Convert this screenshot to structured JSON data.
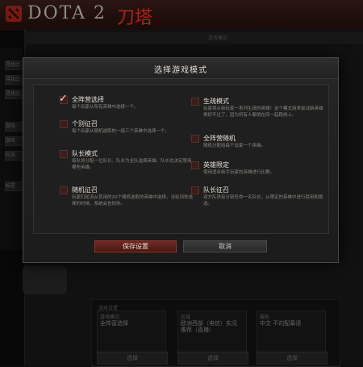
{
  "app": {
    "logo_text": "DOTA 2",
    "logo_cn": "刀塔",
    "topbar_text": "游戏模式"
  },
  "sidebar": {
    "items": [
      "寻找比",
      "寻找比",
      "寻找比",
      "游戏",
      "游戏",
      "队伍",
      "标签"
    ]
  },
  "lobby": {
    "section_title": "游戏设置",
    "columns": [
      {
        "label": "游戏模式",
        "value": "全阵营选择",
        "select": "选择"
      },
      {
        "label": "区域",
        "value": "欧洲西部（电信）实况推荐（直播）",
        "select": "选择"
      },
      {
        "label": "服务",
        "value": "中文 不的配幕语",
        "select": "选择"
      }
    ]
  },
  "dialog": {
    "title": "选择游戏模式",
    "modes_left": [
      {
        "name": "全阵营选择",
        "desc": "每个玩家从所有英雄中选择一个。",
        "checked": true
      },
      {
        "name": "个别征召",
        "desc": "每个玩家从随机选取的一组三个英雄中选择一个。",
        "checked": false
      },
      {
        "name": "队长模式",
        "desc": "每队将分配一位队长。队长为全队选择英雄。队长也决定禁用哪些英雄。",
        "checked": false
      },
      {
        "name": "随机征召",
        "desc": "玩家们轮流从其用的20个随机选取的英雄中选择，当轮到你选择的时候，系统会告知你。",
        "checked": false
      }
    ],
    "modes_right": [
      {
        "name": "生疏模式",
        "desc": "玩家将从新玩家一系列生疏的英雄！这个模式用来尝试新英雄再好不过了。因为所有人都将在同一起跑线上。",
        "checked": false
      },
      {
        "name": "全阵营随机",
        "desc": "随机分配给每个玩家一个英雄。",
        "checked": false
      },
      {
        "name": "英雄限定",
        "desc": "使用适合新手玩家的英雄进行比赛。",
        "checked": false
      },
      {
        "name": "队长征召",
        "desc": "双方队员有分别任命一名队长，从限定的英雄中进行禁用和挑选。",
        "checked": false
      }
    ],
    "save_label": "保存设置",
    "cancel_label": "取消"
  },
  "colors": {
    "accent": "#6d2a22",
    "logo_red": "#b0221a"
  }
}
